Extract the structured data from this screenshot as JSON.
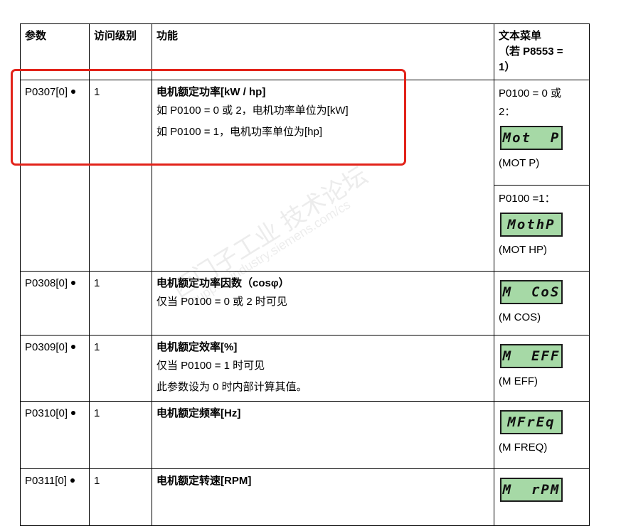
{
  "table": {
    "headers": {
      "param": "参数",
      "access": "访问级别",
      "function": "功能",
      "text_menu_line1": "文本菜单",
      "text_menu_line2": "（若 P8553 =",
      "text_menu_line3": "1）"
    },
    "rows": [
      {
        "param": "P0307[0]",
        "access": "1",
        "title": "电机额定功率[kW / hp]",
        "lines": [
          "如 P0100 = 0 或 2，电机功率单位为[kW]",
          "如 P0100 = 1，电机功率单位为[hp]"
        ],
        "text_menu": [
          {
            "condition_line1": "P0100 = 0 或",
            "condition_line2": "2：",
            "lcd": "Mot  P",
            "caption": "(MOT P)"
          },
          {
            "condition_line1": "P0100 =1：",
            "lcd": "MothP",
            "caption": "(MOT HP)"
          }
        ]
      },
      {
        "param": "P0308[0]",
        "access": "1",
        "title": "电机额定功率因数（cosφ）",
        "lines": [
          "仅当 P0100 = 0 或 2 时可见"
        ],
        "lcd": "M  CoS",
        "caption": "(M COS)"
      },
      {
        "param": "P0309[0]",
        "access": "1",
        "title": "电机额定效率[%]",
        "lines": [
          "仅当 P0100 = 1 时可见",
          "此参数设为 0 时内部计算其值。"
        ],
        "lcd": "M  EFF",
        "caption": "(M EFF)"
      },
      {
        "param": "P0310[0]",
        "access": "1",
        "title": "电机额定频率[Hz]",
        "lines": [],
        "lcd": "MFrEq",
        "caption": "(M FREQ)"
      },
      {
        "param": "P0311[0]",
        "access": "1",
        "title": "电机额定转速[RPM]",
        "lines": [],
        "lcd": "M  rPM",
        "caption": ""
      }
    ]
  },
  "watermark": {
    "line1": "西门子工业  技术论坛",
    "line2": "support.industry.siemens.com/cs"
  },
  "colors": {
    "highlight": "#e2231a",
    "lcd_background": "#a6d9a6"
  }
}
